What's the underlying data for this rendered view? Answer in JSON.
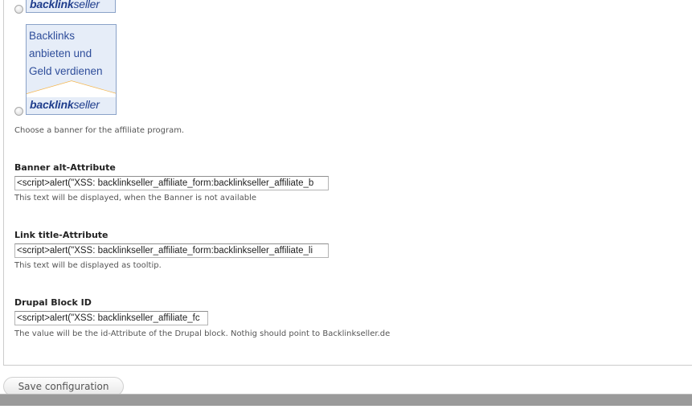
{
  "banners": {
    "small": {
      "brand_bold": "backlink",
      "brand_normal": "seller"
    },
    "large": {
      "headline": "Backlinks\nanbieten und\nGeld verdienen",
      "brand_bold": "backlink",
      "brand_normal": "seller"
    },
    "description": "Choose a banner for the affiliate program."
  },
  "fields": {
    "banner_alt": {
      "label": "Banner alt-Attribute",
      "value": "<script>alert(\"XSS: backlinkseller_affiliate_form:backlinkseller_affiliate_b",
      "description": "This text will be displayed, when the Banner is not available"
    },
    "link_title": {
      "label": "Link title-Attribute",
      "value": "<script>alert(\"XSS: backlinkseller_affiliate_form:backlinkseller_affiliate_li",
      "description": "This text will be displayed as tooltip."
    },
    "block_id": {
      "label": "Drupal Block ID",
      "value": "<script>alert(\"XSS: backlinkseller_affiliate_fc",
      "description": "The value will be the id-Attribute of the Drupal block. Nothig should point to Backlinkseller.de"
    }
  },
  "actions": {
    "save_label": "Save configuration"
  },
  "colors": {
    "brand_blue": "#1f3d8c",
    "headline_blue": "#2e4d9a",
    "banner_bg": "#e6edf8",
    "divider_orange": "#f5b54a"
  }
}
